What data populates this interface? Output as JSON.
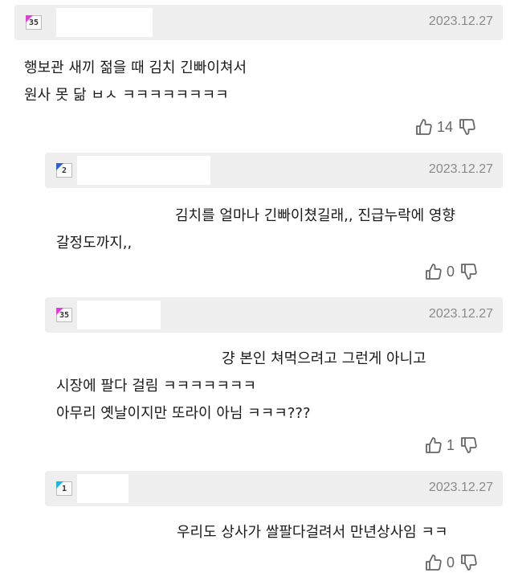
{
  "comments": [
    {
      "level": "35",
      "date": "2023.12.27",
      "lines": [
        "행보관 새끼 젊을 때 김치 긴빠이쳐서",
        "원사 못 닮 ㅂㅅ ㅋㅋㅋㅋㅋㅋㅋㅋ"
      ],
      "likes": "14"
    },
    {
      "level": "2",
      "date": "2023.12.27",
      "lines": [
        "김치를 얼마나 긴빠이쳤길래,, 진급누락에 영향",
        "갈정도까지,,"
      ],
      "likes": "0"
    },
    {
      "level": "35",
      "date": "2023.12.27",
      "lines": [
        "걍 본인 쳐먹으려고 그런게 아니고",
        "시장에 팔다 걸림 ㅋㅋㅋㅋㅋㅋㅋ",
        "아무리 옛날이지만 또라이 아님 ㅋㅋㅋ???"
      ],
      "likes": "1"
    },
    {
      "level": "1",
      "date": "2023.12.27",
      "lines": [
        "우리도 상사가 쌀팔다걸려서 만년상사임 ㅋㅋ"
      ],
      "likes": "0"
    }
  ],
  "icons": {
    "like": "thumbs-up-icon",
    "dislike": "thumbs-down-icon"
  },
  "colors": {
    "header_bg": "#eeeeee",
    "level_high": "#e23bd6",
    "level_low_blue": "#2f5fd0",
    "level_low_cyan": "#19b7e0"
  }
}
